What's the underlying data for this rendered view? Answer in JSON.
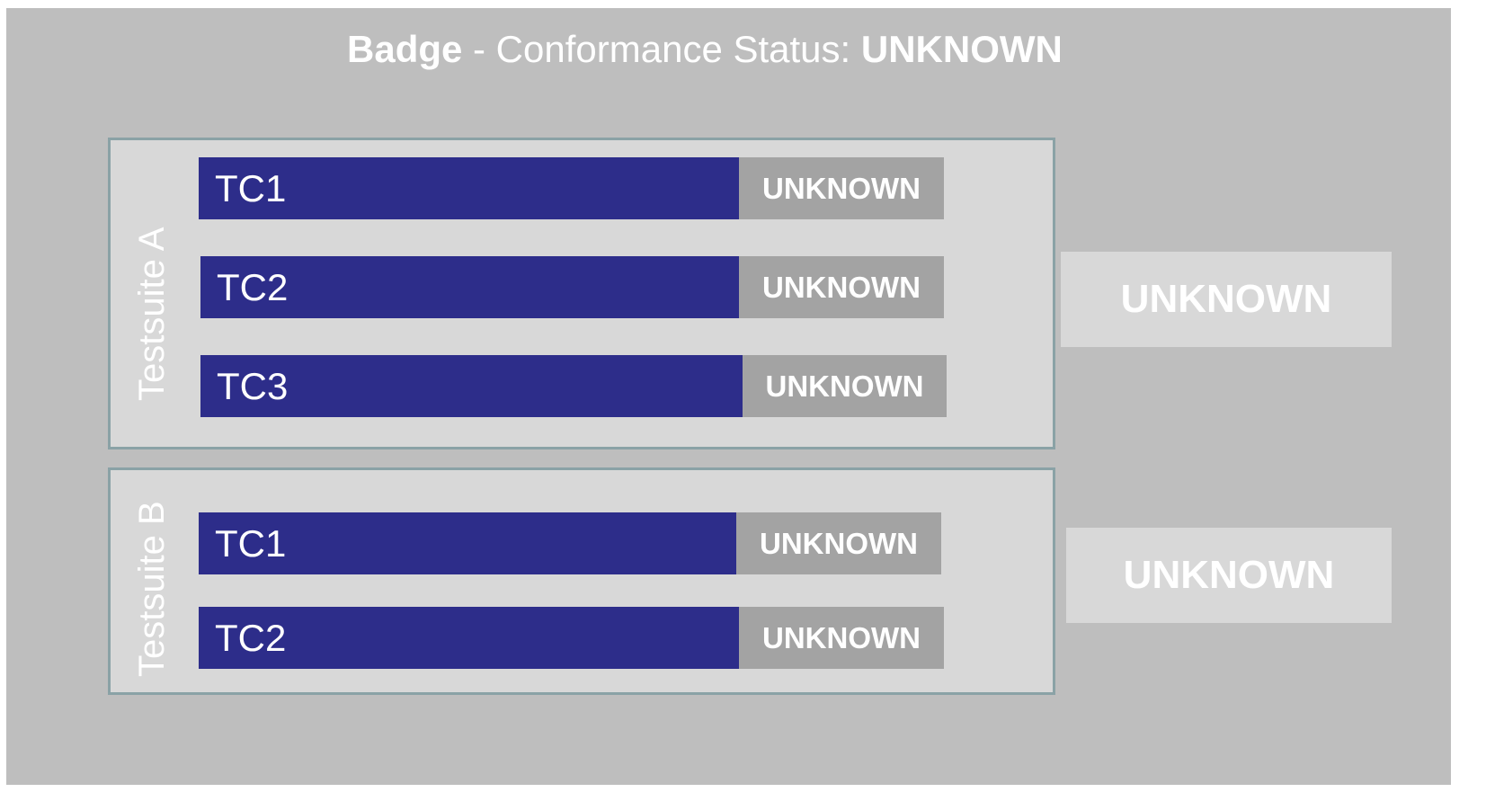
{
  "title": {
    "badge": "Badge",
    "separator": " - Conformance Status: ",
    "status": "UNKNOWN"
  },
  "suites": [
    {
      "label": "Testsuite A",
      "status": "UNKNOWN",
      "cases": [
        {
          "name": "TC1",
          "status": "UNKNOWN"
        },
        {
          "name": "TC2",
          "status": "UNKNOWN"
        },
        {
          "name": "TC3",
          "status": "UNKNOWN"
        }
      ]
    },
    {
      "label": "Testsuite B",
      "status": "UNKNOWN",
      "cases": [
        {
          "name": "TC1",
          "status": "UNKNOWN"
        },
        {
          "name": "TC2",
          "status": "UNKNOWN"
        }
      ]
    }
  ],
  "colors": {
    "background": "#bebebe",
    "suite_fill": "#d8d8d8",
    "suite_border": "#8aa2a6",
    "test_case": "#2d2d8a",
    "status_unknown": "#a3a3a3",
    "text": "#ffffff"
  }
}
